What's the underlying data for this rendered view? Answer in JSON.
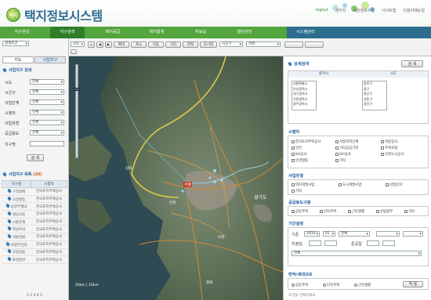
{
  "header": {
    "logo_mark": "택지",
    "title": "택지정보시스템",
    "top_links": [
      "logout",
      "관리자",
      "회원정보수정",
      "사이트맵",
      "이용자매뉴얼"
    ]
  },
  "nav": {
    "items": [
      "지구관리",
      "지구검색",
      "택지공급",
      "택지통계",
      "자료실",
      "열린마당"
    ],
    "active_index": 1,
    "right_item": "시스템관리"
  },
  "left": {
    "select_top": "검색조건",
    "tabs": [
      "지도",
      "사업지구"
    ],
    "section1_title": "사업지구 검색",
    "fields": [
      {
        "label": "시도",
        "value": "전체"
      },
      {
        "label": "시군구",
        "value": "전체"
      },
      {
        "label": "사업단계",
        "value": "전체"
      },
      {
        "label": "시행자",
        "value": "전체"
      },
      {
        "label": "사업유형",
        "value": "전체"
      },
      {
        "label": "공급용도",
        "value": "전체"
      }
    ],
    "name_label": "지구명",
    "search_button": "검 색",
    "section2_title": "사업지구 목록",
    "result_count": "(20)",
    "table_headers": [
      "지구명",
      "시행자"
    ],
    "table_rows": [
      [
        "구리갈매",
        "한국토지주택공사"
      ],
      [
        "고양향동",
        "한국토지주택공사"
      ],
      [
        "남양주별내",
        "한국토지주택공사"
      ],
      [
        "성남고등",
        "한국토지주택공사"
      ],
      [
        "시흥은계",
        "한국토지주택공사"
      ],
      [
        "하남미사",
        "한국토지주택공사"
      ],
      [
        "서울양원",
        "한국토지주택공사"
      ],
      [
        "의정부민락",
        "한국토지주택공사"
      ],
      [
        "고양삼송",
        "한국토지주택공사"
      ],
      [
        "화성동탄",
        "한국토지주택공사"
      ]
    ],
    "pager": "1 2 3 4 5"
  },
  "maptool": {
    "dropdown1": "시도",
    "dropdown2": "시군구",
    "buttons": [
      "확대",
      "축소",
      "이동",
      "거리",
      "면적",
      "초기화"
    ],
    "search_select": "지번"
  },
  "map": {
    "labels": [
      "서울",
      "인천",
      "경기도",
      "강화",
      "수원",
      "평택"
    ],
    "zoom_scale": [
      "20km",
      "10km"
    ]
  },
  "right": {
    "header_title": "상세검색",
    "header_button": "검 색",
    "region_labels": [
      "광역시",
      "시도"
    ],
    "region_list_a": [
      "서울특별시",
      "부산광역시",
      "대구광역시",
      "인천광역시",
      "광주광역시"
    ],
    "region_list_b": [
      "종로구",
      "중구",
      "용산구",
      "성동구",
      "광진구"
    ],
    "implementer_title": "시행자",
    "implementers": [
      "한국토지주택공사",
      "지방자치단체",
      "지방공사",
      "민간",
      "기타공공기관",
      "주택조합",
      "SH공사",
      "GH공사",
      "인천도시공사",
      "민관합동",
      "기타"
    ],
    "project_type_title": "사업유형",
    "project_types": [
      "택지개발사업",
      "도시개발사업",
      "산업단지"
    ],
    "supply_title": "공급용도구분",
    "supply_types": [
      "공동주택",
      "단독주택",
      "근린생활",
      "상업업무",
      "기타"
    ],
    "period_title": "기간설정",
    "period_fields": [
      {
        "label": "기준",
        "v1": "2010",
        "v2": "01",
        "v3": "전체"
      },
      {
        "label": "지정일",
        "v1": "전체"
      },
      {
        "label": "준공일",
        "v1": "전체"
      }
    ],
    "area_title": "면적/세대규모",
    "area_button": "적 용",
    "footer_text": "조건을 선택하세요"
  }
}
